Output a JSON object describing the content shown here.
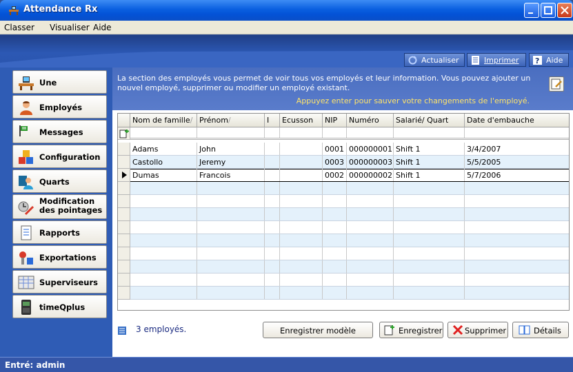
{
  "window": {
    "title": "Attendance Rx"
  },
  "menu": [
    "Classer",
    "Visualiser",
    "Aide"
  ],
  "toolbar": {
    "refresh": "Actualiser",
    "print": "Imprimer",
    "help": "Aide"
  },
  "sidebar": {
    "items": [
      {
        "label": "Une",
        "icon": "desk-icon"
      },
      {
        "label": "Employés",
        "icon": "person-icon"
      },
      {
        "label": "Messages",
        "icon": "flag-icon"
      },
      {
        "label": "Configuration",
        "icon": "blocks-icon"
      },
      {
        "label": "Quarts",
        "icon": "people-icon"
      },
      {
        "label": "Modification des pointages",
        "icon": "punch-edit-icon"
      },
      {
        "label": "Rapports",
        "icon": "report-icon"
      },
      {
        "label": "Exportations",
        "icon": "export-icon"
      },
      {
        "label": "Superviseurs",
        "icon": "supervisor-icon"
      },
      {
        "label": "timeQplus",
        "icon": "timeclock-icon"
      }
    ]
  },
  "info": {
    "description": "La section des employés vous permet de voir tous vos employés et leur information.  Vous pouvez ajouter un nouvel employé, supprimer ou modifier un employé existant.",
    "hint": "Appuyez enter pour sauver votre changements de l'employé."
  },
  "grid": {
    "columns": [
      "Nom de famille",
      "Prénom",
      "I",
      "Ecusson",
      "NIP",
      "Numéro",
      "Salarié/ Quart",
      "Date d'embauche"
    ],
    "sort_marks": [
      "/",
      "/",
      "",
      "",
      "",
      "",
      "",
      ""
    ],
    "rows": [
      [
        "Adams",
        "John",
        "",
        "",
        "0001",
        "000000001",
        "Shift 1",
        "3/4/2007"
      ],
      [
        "Castollo",
        "Jeremy",
        "",
        "",
        "0003",
        "000000003",
        "Shift 1",
        "5/5/2005"
      ],
      [
        "Dumas",
        "Francois",
        "",
        "",
        "0002",
        "000000002",
        "Shift 1",
        "5/7/2006"
      ]
    ],
    "selected_row": 2,
    "empty_rows": 9
  },
  "footer": {
    "count": "3 employés.",
    "save_template": "Enregistrer modèle",
    "save": "Enregistrer",
    "delete": "Supprimer",
    "details": "Détails"
  },
  "status": {
    "text": "Entré: admin"
  }
}
